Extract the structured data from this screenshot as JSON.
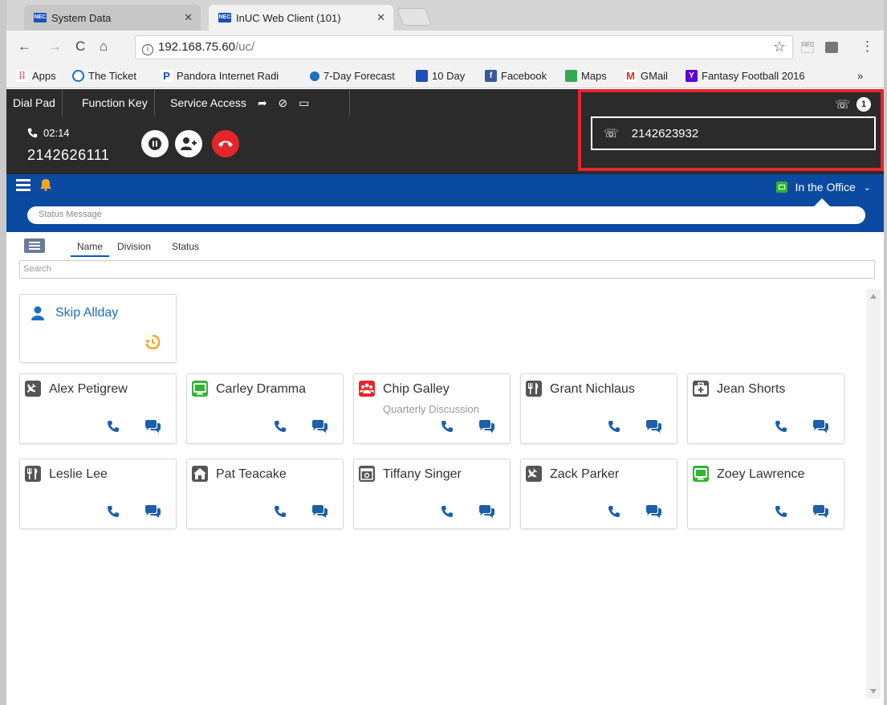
{
  "browser": {
    "tabs": [
      {
        "label": "System Data",
        "active": false
      },
      {
        "label": "InUC Web Client (101)",
        "active": true
      }
    ],
    "url_host": "192.168.75.60",
    "url_path": "/uc/",
    "bookmarks": [
      {
        "label": "Apps",
        "icon": "apps-grid-icon"
      },
      {
        "label": "The Ticket",
        "icon": "ticket-icon"
      },
      {
        "label": "Pandora Internet Radi",
        "icon": "pandora-icon"
      },
      {
        "label": "7-Day Forecast",
        "icon": "forecast-icon"
      },
      {
        "label": "10 Day",
        "icon": "weather-channel-icon"
      },
      {
        "label": "Facebook",
        "icon": "facebook-icon"
      },
      {
        "label": "Maps",
        "icon": "maps-icon"
      },
      {
        "label": "GMail",
        "icon": "gmail-icon"
      },
      {
        "label": "Fantasy Football 2016",
        "icon": "yahoo-icon"
      }
    ],
    "bookmarks_overflow": "»"
  },
  "appbar": {
    "dial_pad": "Dial Pad",
    "function_key": "Function Key",
    "service_access": "Service Access"
  },
  "call": {
    "timer": "02:14",
    "number": "2142626111"
  },
  "incoming": {
    "count": "1",
    "number": "2142623932"
  },
  "presence": {
    "status": "In the Office",
    "status_placeholder": "Status Message"
  },
  "filters": {
    "tabs": [
      "Name",
      "Division",
      "Status"
    ],
    "active": "Name",
    "search_placeholder": "Search"
  },
  "me": {
    "name": "Skip Allday"
  },
  "contacts": [
    {
      "name": "Alex Petigrew",
      "status_icon": "airplane-icon",
      "color": "#555555",
      "sub": ""
    },
    {
      "name": "Carley Dramma",
      "status_icon": "monitor-icon",
      "color": "#2fb52f",
      "sub": ""
    },
    {
      "name": "Chip Galley",
      "status_icon": "meeting-icon",
      "color": "#e4262b",
      "sub": "Quarterly Discussion"
    },
    {
      "name": "Grant Nichlaus",
      "status_icon": "fork-knife-icon",
      "color": "#555555",
      "sub": ""
    },
    {
      "name": "Jean Shorts",
      "status_icon": "medical-icon",
      "color": "#555555",
      "sub": ""
    },
    {
      "name": "Leslie Lee",
      "status_icon": "fork-knife-icon",
      "color": "#555555",
      "sub": ""
    },
    {
      "name": "Pat Teacake",
      "status_icon": "home-icon",
      "color": "#555555",
      "sub": ""
    },
    {
      "name": "Tiffany Singer",
      "status_icon": "calendar-icon",
      "color": "#555555",
      "sub": ""
    },
    {
      "name": "Zack Parker",
      "status_icon": "airplane-icon",
      "color": "#555555",
      "sub": ""
    },
    {
      "name": "Zoey Lawrence",
      "status_icon": "monitor-icon",
      "color": "#2fb52f",
      "sub": ""
    }
  ],
  "colors": {
    "accent_blue": "#0a4aa0",
    "link_blue": "#1d6fbf",
    "hangup_red": "#e4262b",
    "dark": "#2b2b2b"
  }
}
